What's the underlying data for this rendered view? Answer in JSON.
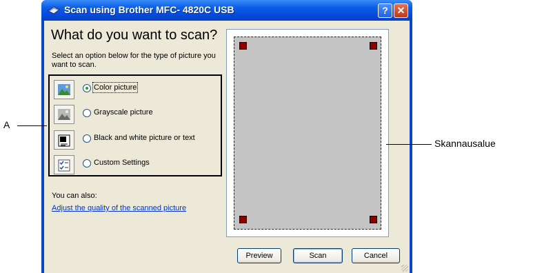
{
  "window": {
    "title": "Scan using Brother MFC- 4820C USB"
  },
  "main": {
    "heading": "What do you want to scan?",
    "description": "Select an option below for the type of picture you want to scan.",
    "options": [
      {
        "label": "Color picture",
        "icon": "color-picture-icon",
        "selected": true
      },
      {
        "label": "Grayscale picture",
        "icon": "grayscale-picture-icon",
        "selected": false
      },
      {
        "label": "Black and white picture or text",
        "icon": "bw-picture-text-icon",
        "selected": false
      },
      {
        "label": "Custom Settings",
        "icon": "custom-settings-icon",
        "selected": false
      }
    ],
    "also_label": "You can also:",
    "adjust_link": "Adjust the quality of the scanned picture"
  },
  "buttons": {
    "preview": "Preview",
    "scan": "Scan",
    "cancel": "Cancel"
  },
  "annotations": {
    "left": "A",
    "right": "Skannausalue"
  },
  "colors": {
    "title_blue": "#0549d8",
    "dialog_bg": "#ece9d8",
    "link": "#0033cc",
    "handle": "#8b0000",
    "scan_area": "#c4c4c4"
  }
}
